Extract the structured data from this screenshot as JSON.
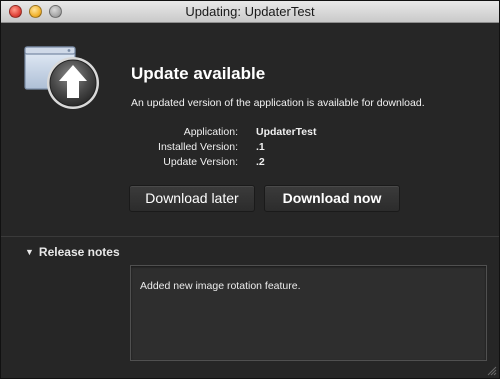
{
  "window": {
    "title": "Updating: UpdaterTest",
    "controls": [
      "close",
      "minimize",
      "zoom"
    ]
  },
  "icon": "upload-arrow-app-icon",
  "headline": "Update available",
  "subline": "An updated version of the application is available for download.",
  "details": [
    {
      "label": "Application:",
      "value": "UpdaterTest"
    },
    {
      "label": "Installed Version:",
      "value": ".1"
    },
    {
      "label": "Update Version:",
      "value": ".2"
    }
  ],
  "buttons": {
    "later": "Download later",
    "now": "Download now"
  },
  "release_notes": {
    "label": "Release notes",
    "expanded": true,
    "text": "Added new image rotation feature."
  },
  "colors": {
    "background": "#262626",
    "text": "#ffffff",
    "titlebar": "#d8d8d8"
  }
}
